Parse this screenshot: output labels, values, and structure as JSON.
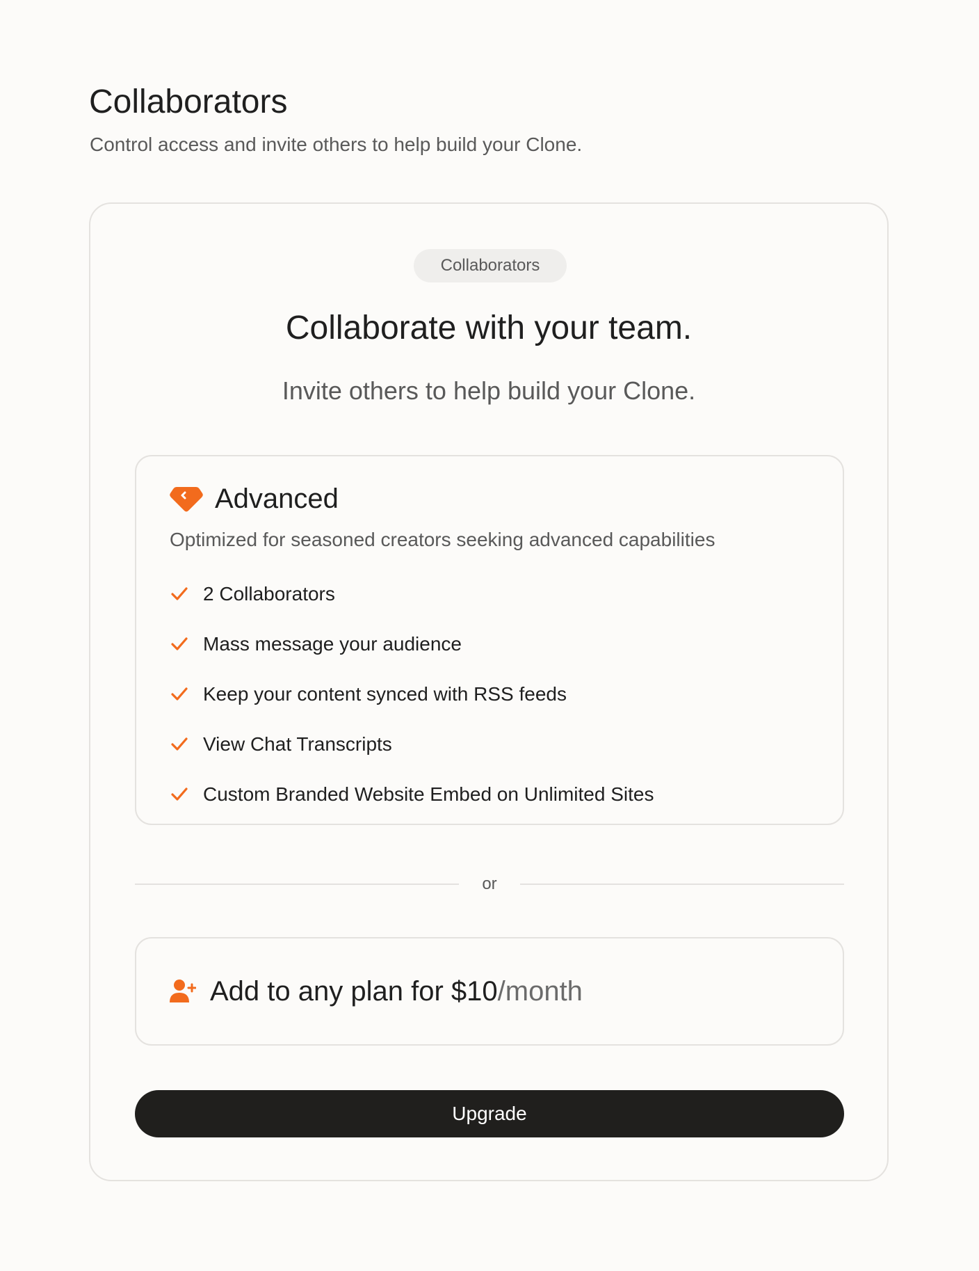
{
  "page": {
    "title": "Collaborators",
    "subtitle": "Control access and invite others to help build your Clone."
  },
  "card": {
    "pill_label": "Collaborators",
    "heading": "Collaborate with your team.",
    "subheading": "Invite others to help build your Clone."
  },
  "plan": {
    "icon": "diamond-tag-icon",
    "name": "Advanced",
    "description": "Optimized for seasoned creators seeking advanced capabilities",
    "features": [
      "2 Collaborators",
      "Mass message your audience",
      "Keep your content synced with RSS feeds",
      "View Chat Transcripts",
      "Custom Branded Website Embed on Unlimited Sites"
    ]
  },
  "divider": {
    "text": "or"
  },
  "addon": {
    "icon": "add-user-icon",
    "text": "Add to any plan for $10",
    "unit": "/month"
  },
  "upgrade_button": {
    "label": "Upgrade"
  },
  "colors": {
    "accent": "#f26b1d",
    "button": "#201f1d",
    "background": "#fcfbf9",
    "border": "#e4e2df"
  }
}
